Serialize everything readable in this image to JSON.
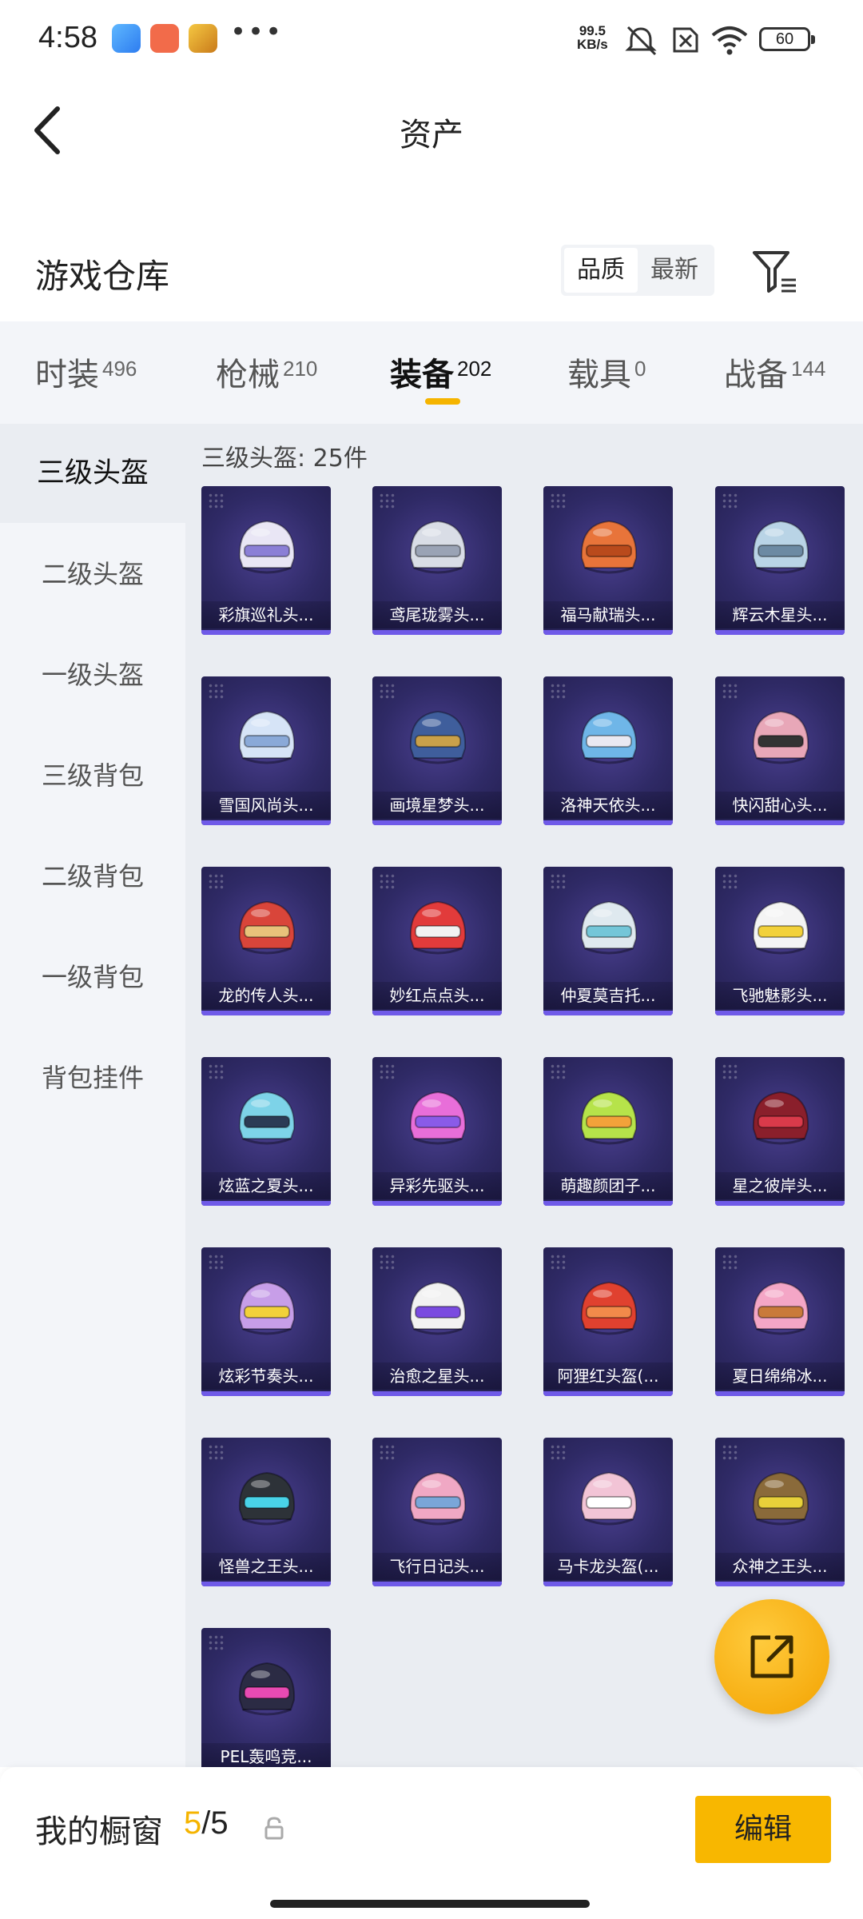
{
  "status_bar": {
    "time": "4:58",
    "more": "•••",
    "net_speed_value": "99.5",
    "net_speed_unit": "KB/s",
    "battery": "60"
  },
  "header": {
    "title": "资产",
    "back_icon": "chevron-left-icon"
  },
  "warehouse": {
    "title": "游戏仓库",
    "sort_options": [
      "品质",
      "最新"
    ],
    "sort_selected": "品质",
    "filter_icon": "filter-icon"
  },
  "tabs": [
    {
      "label": "时装",
      "count": "496"
    },
    {
      "label": "枪械",
      "count": "210"
    },
    {
      "label": "装备",
      "count": "202",
      "active": true
    },
    {
      "label": "载具",
      "count": "0"
    },
    {
      "label": "战备",
      "count": "144"
    }
  ],
  "sidebar": {
    "items": [
      "三级头盔",
      "二级头盔",
      "一级头盔",
      "三级背包",
      "二级背包",
      "一级背包",
      "背包挂件"
    ],
    "selected": "三级头盔"
  },
  "content": {
    "count_label": "三级头盔: 25件",
    "items": [
      "彩旗巡礼头...",
      "鸢尾珑雾头...",
      "福马献瑞头...",
      "辉云木星头...",
      "雪国风尚头...",
      "画境星梦头...",
      "洛神天依头...",
      "快闪甜心头...",
      "龙的传人头...",
      "妙红点点头...",
      "仲夏莫吉托...",
      "飞驰魅影头...",
      "炫蓝之夏头...",
      "异彩先驱头...",
      "萌趣颜团子...",
      "星之彼岸头...",
      "炫彩节奏头...",
      "治愈之星头...",
      "阿狸红头盔(...",
      "夏日绵绵冰...",
      "怪兽之王头...",
      "飞行日记头...",
      "马卡龙头盔(...",
      "众神之王头...",
      "PEL轰鸣竞..."
    ]
  },
  "fab": {
    "icon": "share-icon"
  },
  "bottom_bar": {
    "showcase_label": "我的橱窗",
    "showcase_current": "5",
    "showcase_total": "/5",
    "lock_icon": "lock-icon",
    "edit_label": "编辑"
  },
  "colors": {
    "accent": "#f5b400",
    "card_bg": "#2f2a66",
    "card_bar": "#6f5ae8"
  }
}
